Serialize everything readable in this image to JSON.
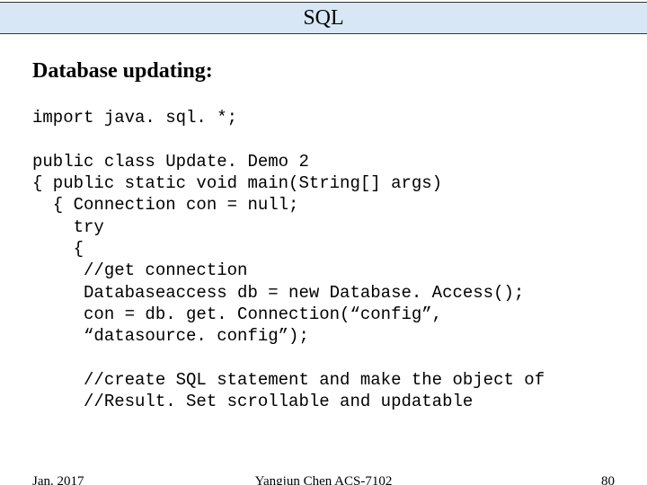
{
  "title": "SQL",
  "heading": "Database updating:",
  "code": "import java. sql. *;\n\npublic class Update. Demo 2\n{ public static void main(String[] args)\n  { Connection con = null;\n    try\n    {\n     //get connection\n     Databaseaccess db = new Database. Access();\n     con = db. get. Connection(“config”,\n     “datasource. config”);\n\n     //create SQL statement and make the object of\n     //Result. Set scrollable and updatable",
  "footer": {
    "left": "Jan. 2017",
    "center": "Yangjun Chen        ACS-7102",
    "right": "80"
  }
}
